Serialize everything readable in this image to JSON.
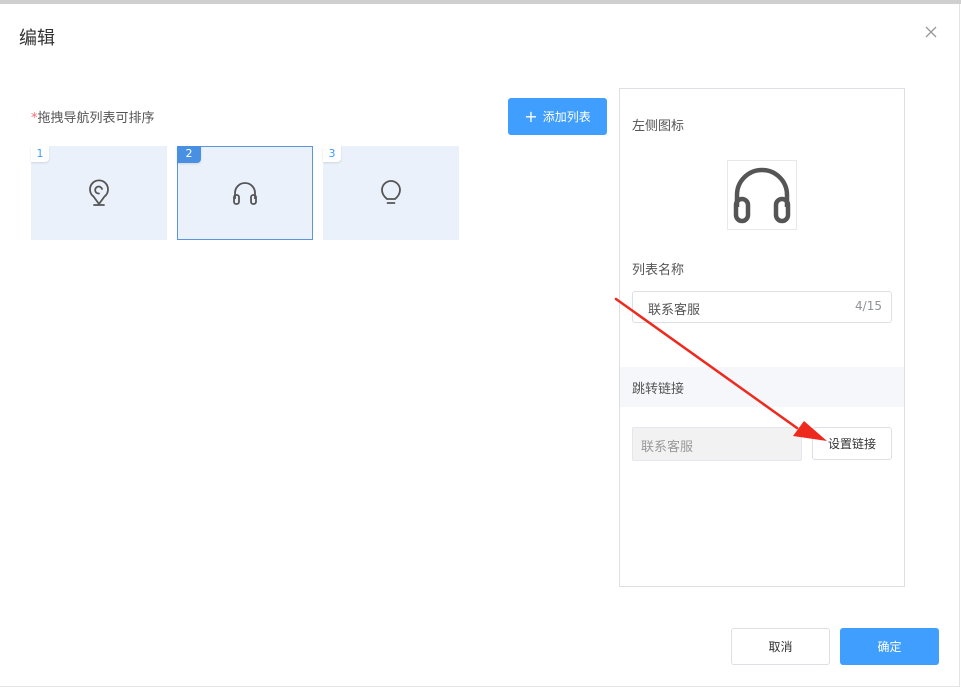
{
  "dialog": {
    "title": "编辑",
    "close_icon": "close-icon"
  },
  "left": {
    "required_mark": "*",
    "drag_hint": "拖拽导航列表可排序",
    "add_button_label": "添加列表",
    "add_icon": "plus-icon",
    "items": [
      {
        "index": "1",
        "icon": "location-pin-icon",
        "selected": false
      },
      {
        "index": "2",
        "icon": "headphones-icon",
        "selected": true
      },
      {
        "index": "3",
        "icon": "lightbulb-icon",
        "selected": false
      }
    ]
  },
  "right": {
    "left_icon_label": "左侧图标",
    "left_icon": "headphones-icon",
    "list_name_label": "列表名称",
    "list_name_value": "联系客服",
    "list_name_count": "4/15",
    "jump_link_label": "跳转链接",
    "link_value": "联系客服",
    "set_link_label": "设置链接"
  },
  "footer": {
    "cancel_label": "取消",
    "confirm_label": "确定"
  },
  "colors": {
    "primary": "#409eff",
    "card_bg": "#ebf1fb",
    "selected_border": "#5a95e0",
    "annotation_arrow": "#ee2a1e"
  }
}
